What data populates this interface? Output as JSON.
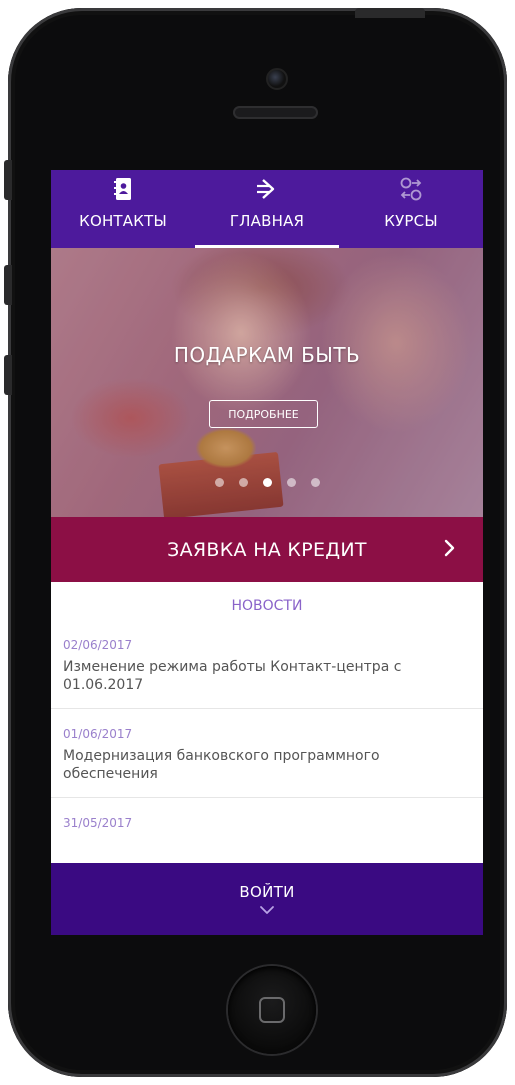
{
  "nav": {
    "tabs": [
      {
        "label": "КОНТАКТЫ",
        "icon": "contacts-book-icon"
      },
      {
        "label": "ГЛАВНАЯ",
        "icon": "home-arrow-icon",
        "active": true
      },
      {
        "label": "КУРСЫ",
        "icon": "currency-exchange-icon"
      }
    ]
  },
  "banner": {
    "title": "ПОДАРКАМ БЫТЬ",
    "button_label": "ПОДРОБНЕЕ",
    "slide_count": 5,
    "active_slide": 3
  },
  "credit": {
    "label": "ЗАЯВКА НА КРЕДИТ",
    "icon": "chevron-right-icon"
  },
  "news": {
    "heading": "НОВОСТИ",
    "items": [
      {
        "date": "02/06/2017",
        "text": "Изменение режима работы Контакт-центра с 01.06.2017"
      },
      {
        "date": "01/06/2017",
        "text": "Модернизация банковского программного обеспечения"
      },
      {
        "date": "31/05/2017",
        "text": ""
      }
    ]
  },
  "login": {
    "label": "ВОЙТИ",
    "icon": "chevron-down-icon"
  },
  "colors": {
    "nav_bg": "#4d1a9c",
    "credit_bg": "#8c0f45",
    "login_bg": "#3a0a82",
    "news_accent": "#8a63c9"
  }
}
